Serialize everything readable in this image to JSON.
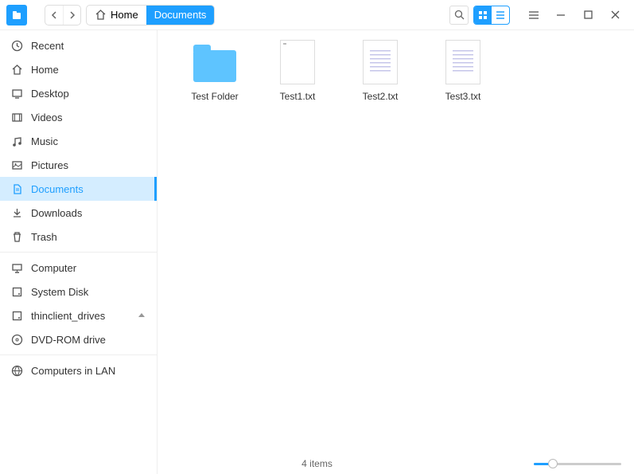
{
  "breadcrumb": [
    {
      "label": "Home",
      "icon": "home",
      "active": false
    },
    {
      "label": "Documents",
      "icon": null,
      "active": true
    }
  ],
  "sidebar": {
    "groups": [
      [
        {
          "id": "recent",
          "label": "Recent",
          "icon": "clock",
          "active": false
        },
        {
          "id": "home",
          "label": "Home",
          "icon": "home",
          "active": false
        },
        {
          "id": "desktop",
          "label": "Desktop",
          "icon": "desktop",
          "active": false
        },
        {
          "id": "videos",
          "label": "Videos",
          "icon": "video",
          "active": false
        },
        {
          "id": "music",
          "label": "Music",
          "icon": "music",
          "active": false
        },
        {
          "id": "pictures",
          "label": "Pictures",
          "icon": "picture",
          "active": false
        },
        {
          "id": "documents",
          "label": "Documents",
          "icon": "document",
          "active": true
        },
        {
          "id": "downloads",
          "label": "Downloads",
          "icon": "download",
          "active": false
        },
        {
          "id": "trash",
          "label": "Trash",
          "icon": "trash",
          "active": false
        }
      ],
      [
        {
          "id": "computer",
          "label": "Computer",
          "icon": "computer",
          "active": false
        },
        {
          "id": "system-disk",
          "label": "System Disk",
          "icon": "disk",
          "active": false
        },
        {
          "id": "thinclient",
          "label": "thinclient_drives",
          "icon": "disk",
          "active": false,
          "eject": true
        },
        {
          "id": "dvd",
          "label": "DVD-ROM drive",
          "icon": "dvd",
          "active": false
        }
      ],
      [
        {
          "id": "lan",
          "label": "Computers in LAN",
          "icon": "network",
          "active": false
        }
      ]
    ]
  },
  "items": [
    {
      "name": "Test Folder",
      "type": "folder"
    },
    {
      "name": "Test1.txt",
      "type": "file-blank"
    },
    {
      "name": "Test2.txt",
      "type": "file-text"
    },
    {
      "name": "Test3.txt",
      "type": "file-text"
    }
  ],
  "status": {
    "count_text": "4 items"
  },
  "colors": {
    "accent": "#1e9fff"
  }
}
